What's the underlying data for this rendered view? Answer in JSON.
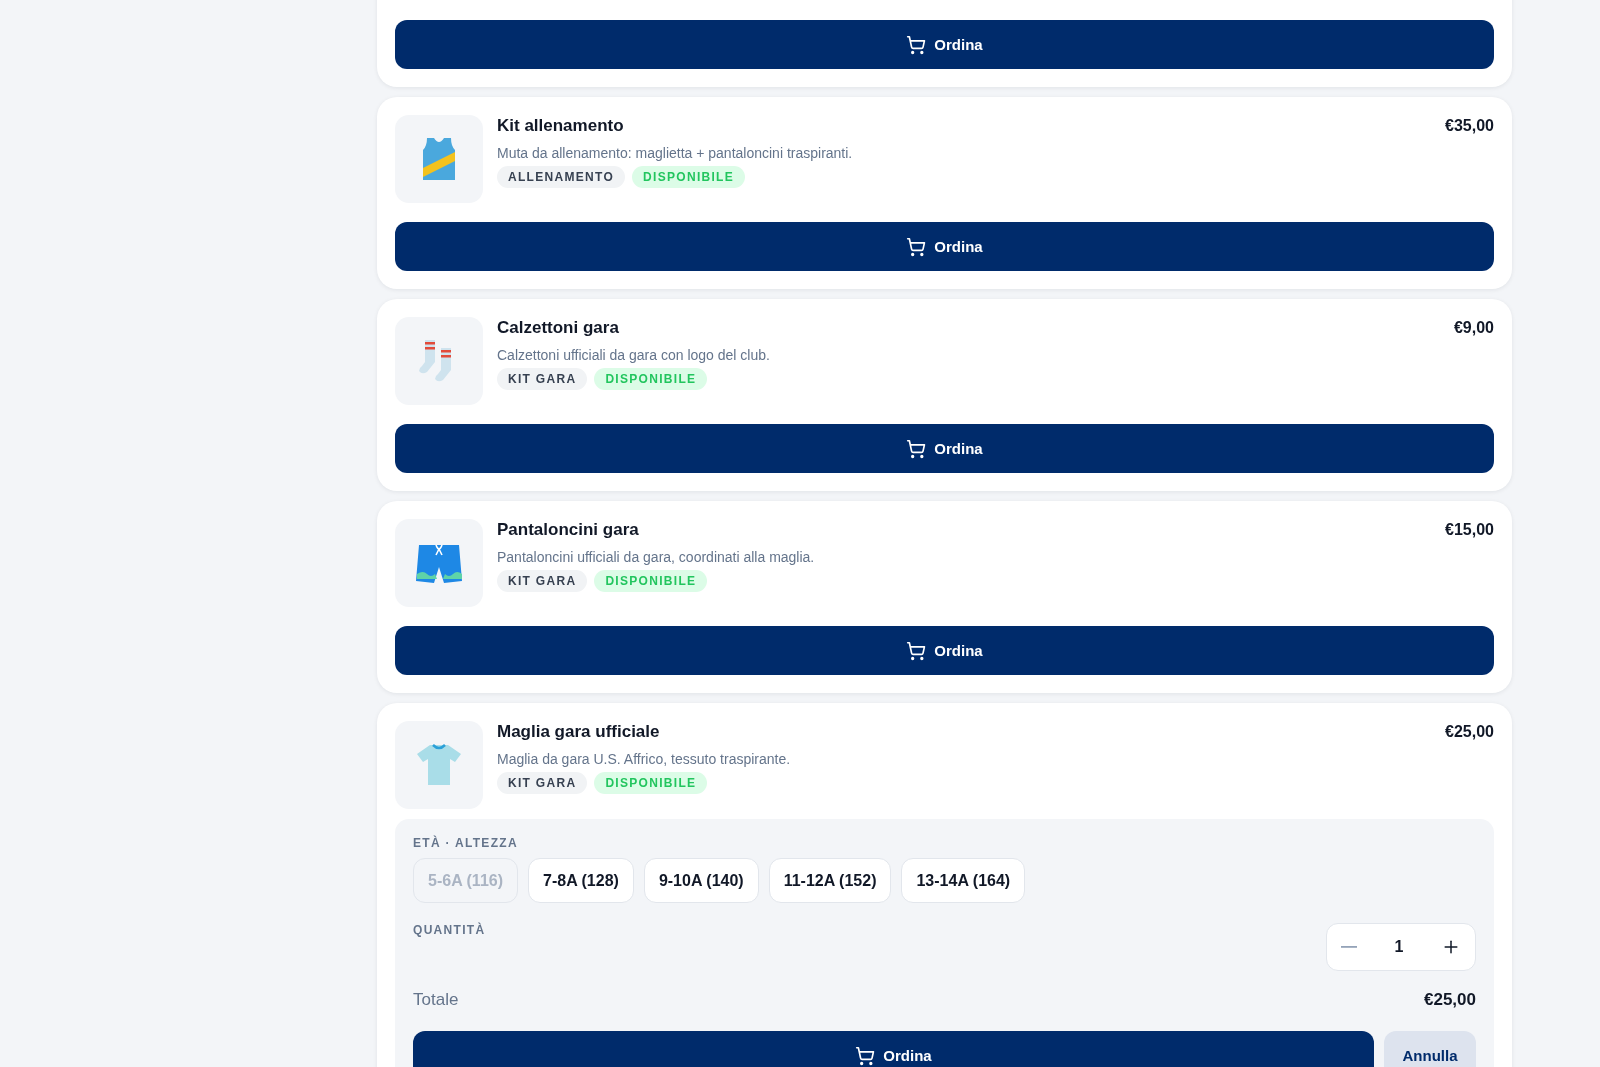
{
  "products": [
    {
      "order_button": "Ordina"
    },
    {
      "name": "Kit allenamento",
      "price": "€35,00",
      "description": "Muta da allenamento: maglietta + pantaloncini traspiranti.",
      "tags": [
        {
          "text": "ALLENAMENTO",
          "kind": "category"
        },
        {
          "text": "DISPONIBILE",
          "kind": "status"
        }
      ],
      "order_button": "Ordina"
    },
    {
      "name": "Calzettoni gara",
      "price": "€9,00",
      "description": "Calzettoni ufficiali da gara con logo del club.",
      "tags": [
        {
          "text": "KIT GARA",
          "kind": "category"
        },
        {
          "text": "DISPONIBILE",
          "kind": "status"
        }
      ],
      "order_button": "Ordina"
    },
    {
      "name": "Pantaloncini gara",
      "price": "€15,00",
      "description": "Pantaloncini ufficiali da gara, coordinati alla maglia.",
      "tags": [
        {
          "text": "KIT GARA",
          "kind": "category"
        },
        {
          "text": "DISPONIBILE",
          "kind": "status"
        }
      ],
      "order_button": "Ordina"
    },
    {
      "name": "Maglia gara ufficiale",
      "price": "€25,00",
      "description": "Maglia da gara U.S. Affrico, tessuto traspirante.",
      "tags": [
        {
          "text": "KIT GARA",
          "kind": "category"
        },
        {
          "text": "DISPONIBILE",
          "kind": "status"
        }
      ],
      "options": {
        "size_label": "ETÀ · ALTEZZA",
        "sizes": [
          {
            "label": "5-6A (116)",
            "disabled": true,
            "selected": false
          },
          {
            "label": "7-8A (128)",
            "disabled": false,
            "selected": false
          },
          {
            "label": "9-10A (140)",
            "disabled": false,
            "selected": false
          },
          {
            "label": "11-12A (152)",
            "disabled": false,
            "selected": false
          },
          {
            "label": "13-14A (164)",
            "disabled": false,
            "selected": false
          }
        ],
        "quantity_label": "QUANTITÀ",
        "quantity": "1",
        "minus_disabled": true,
        "total_label": "Totale",
        "total": "€25,00",
        "cancel_button": "Annulla"
      },
      "order_button": "Ordina"
    }
  ]
}
